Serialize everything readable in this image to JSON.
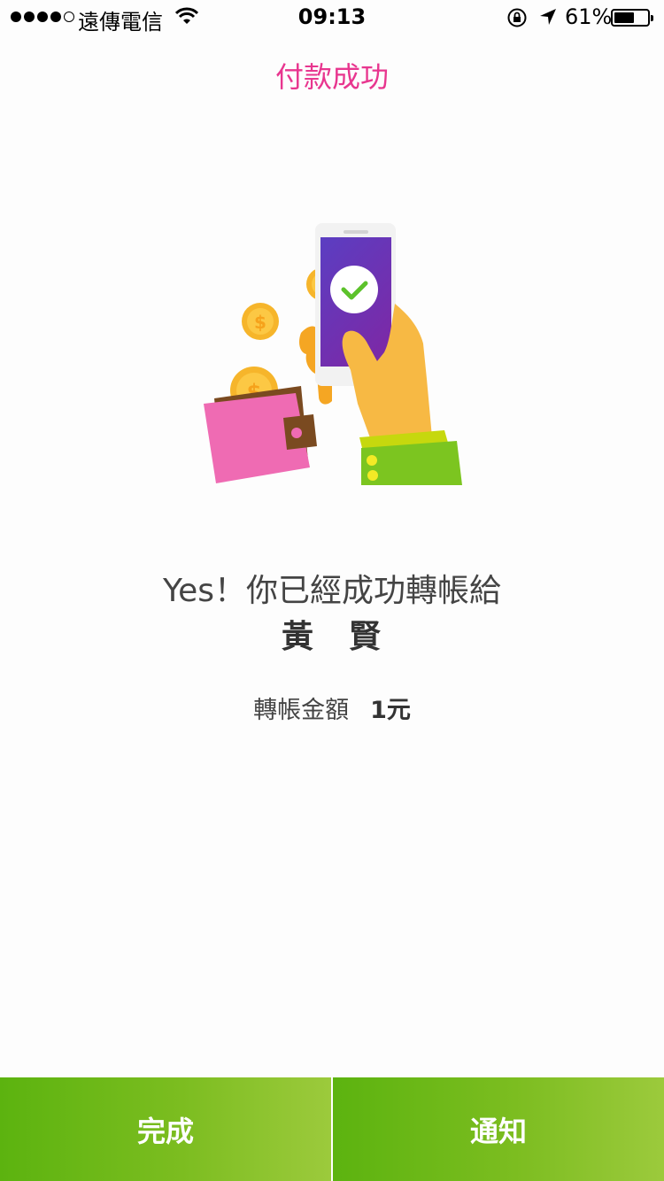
{
  "status_bar": {
    "carrier": "遠傳電信",
    "time": "09:13",
    "battery_percent": "61%",
    "battery_level": 0.61,
    "icons": [
      "signal-dots-icon",
      "wifi-icon",
      "rotation-lock-icon",
      "location-arrow-icon",
      "battery-icon"
    ]
  },
  "page": {
    "title": "付款成功"
  },
  "illustration": {
    "icons": [
      "wallet-icon",
      "coin-icon",
      "phone-icon",
      "checkmark-icon",
      "hand-icon"
    ],
    "colors": {
      "wallet": "#ef6bb3",
      "coin": "#f6b52b",
      "phone_screen": "#6a35b8",
      "sleeve": "#7cc520",
      "check": "#6cc42a"
    }
  },
  "result": {
    "headline": "Yes！你已經成功轉帳給",
    "recipient": "黃　賢",
    "amount_label": "轉帳金額",
    "amount_value": "1元"
  },
  "actions": {
    "done_label": "完成",
    "notify_label": "通知"
  },
  "colors": {
    "title": "#e8368f",
    "button_start": "#5cb30f",
    "button_end": "#9cca3c"
  }
}
